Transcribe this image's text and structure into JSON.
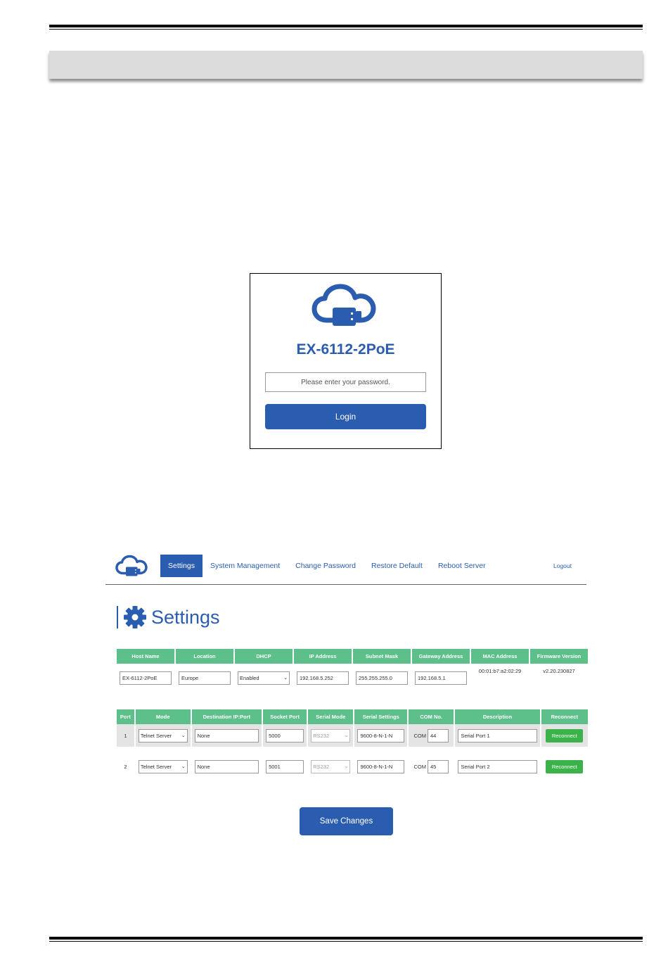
{
  "login": {
    "device_name": "EX-6112-2PoE",
    "password_placeholder": "Please enter your password.",
    "login_label": "Login"
  },
  "nav": {
    "items": [
      "Settings",
      "System Management",
      "Change Password",
      "Restore Default",
      "Reboot Server"
    ],
    "active": "Settings",
    "logout_label": "Logout"
  },
  "page": {
    "title": "Settings"
  },
  "host_table": {
    "headers": [
      "Host Name",
      "Location",
      "DHCP",
      "IP Address",
      "Subnet Mask",
      "Gateway Address",
      "MAC Address",
      "Firmware Version"
    ],
    "values": {
      "host_name": "EX-6112-2PoE",
      "location": "Europe",
      "dhcp": "Enabled",
      "ip_address": "192.168.5.252",
      "subnet_mask": "255.255.255.0",
      "gateway": "192.168.5.1",
      "mac": "00:01:b7:a2:02:29",
      "firmware": "v2.20.230827"
    }
  },
  "port_table": {
    "headers": [
      "Port",
      "Mode",
      "Destination IP:Port",
      "Socket Port",
      "Serial Mode",
      "Serial Settings",
      "COM No.",
      "Description",
      "Reconnect"
    ],
    "com_prefix": "COM",
    "reconnect_label": "Reconnect",
    "rows": [
      {
        "port": "1",
        "mode": "Telnet Server",
        "destination": "None",
        "socket_port": "5000",
        "serial_mode": "RS232",
        "serial_settings": "9600-8-N-1-N",
        "com_no": "44",
        "description": "Serial Port 1"
      },
      {
        "port": "2",
        "mode": "Telnet Server",
        "destination": "None",
        "socket_port": "5001",
        "serial_mode": "RS232",
        "serial_settings": "9600-8-N-1-N",
        "com_no": "45",
        "description": "Serial Port 2"
      }
    ]
  },
  "save_label": "Save Changes",
  "colors": {
    "brand_blue": "#2a5db0",
    "header_green": "#5dc08a",
    "button_green": "#3cb34a"
  }
}
